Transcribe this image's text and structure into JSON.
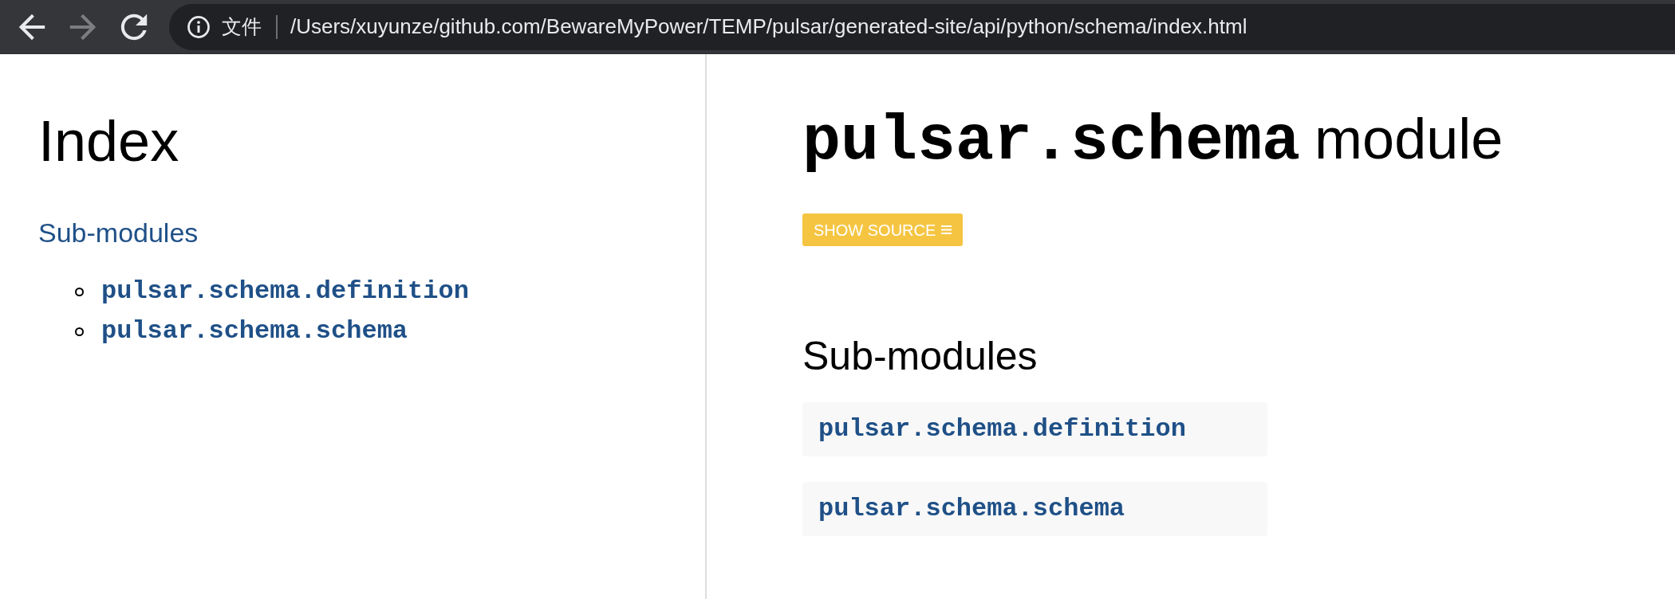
{
  "browser": {
    "nav_buttons": [
      {
        "kind": "back",
        "disabled": false
      },
      {
        "kind": "forward",
        "disabled": true
      },
      {
        "kind": "reload",
        "disabled": false
      }
    ],
    "address_bar": {
      "security_label": "文件",
      "url": "/Users/xuyunze/github.com/BewareMyPower/TEMP/pulsar/generated-site/api/python/schema/index.html"
    }
  },
  "sidebar": {
    "title": "Index",
    "section_title": "Sub-modules",
    "items": [
      {
        "label": "pulsar.schema.definition"
      },
      {
        "label": "pulsar.schema.schema"
      }
    ]
  },
  "main": {
    "title_code": "pulsar.schema",
    "title_suffix": "module",
    "show_source_button": {
      "label": "SHOW SOURCE"
    },
    "section_title": "Sub-modules",
    "submodules": [
      {
        "label": "pulsar.schema.definition"
      },
      {
        "label": "pulsar.schema.schema"
      }
    ]
  }
}
